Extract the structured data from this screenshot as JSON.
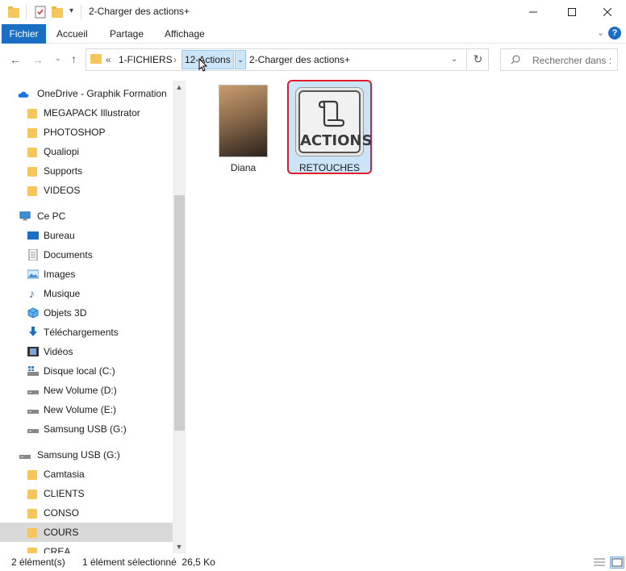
{
  "window": {
    "title": "2-Charger des actions+",
    "minimize_icon": "minimize-icon",
    "maximize_icon": "maximize-icon",
    "close_icon": "close-icon"
  },
  "ribbon": {
    "tabs": [
      "Fichier",
      "Accueil",
      "Partage",
      "Affichage"
    ],
    "help": "?",
    "accent": "#1a6fc4"
  },
  "address": {
    "overflow": "«",
    "crumbs": [
      "1-FICHIERS",
      "12-Actions",
      "2-Charger des actions+"
    ],
    "separator": "›"
  },
  "search": {
    "placeholder": "Rechercher dans :"
  },
  "nav": {
    "onedrive": {
      "label": "OneDrive - Graphik Formation",
      "items": [
        "MEGAPACK Illustrator",
        "PHOTOSHOP",
        "Qualiopi",
        "Supports",
        "VIDEOS"
      ]
    },
    "thispc": {
      "label": "Ce PC",
      "items": [
        "Bureau",
        "Documents",
        "Images",
        "Musique",
        "Objets 3D",
        "Téléchargements",
        "Vidéos",
        "Disque local (C:)",
        "New Volume (D:)",
        "New Volume (E:)",
        "Samsung USB (G:)"
      ]
    },
    "usb": {
      "label": "Samsung USB (G:)",
      "items": [
        "Camtasia",
        "CLIENTS",
        "CONSO",
        "COURS",
        "CREA"
      ],
      "selected": "COURS"
    }
  },
  "content": {
    "files": [
      {
        "name": "Diana",
        "type": "image"
      },
      {
        "name": "RETOUCHES",
        "type": "action",
        "icon_text": "ACTIONS",
        "selected": true
      }
    ]
  },
  "status": {
    "count": "2 élément(s)",
    "selection": "1 élément sélectionné  26,5 Ko"
  }
}
